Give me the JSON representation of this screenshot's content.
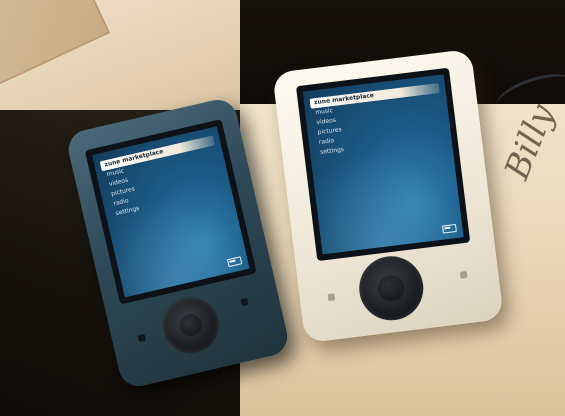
{
  "scene": {
    "description": "",
    "colors": {
      "dark_surface": "#17120d",
      "light_surface": "#ece0c6",
      "dark_device": "#2f4a58",
      "white_device": "#efe8d8",
      "screen_blue": "#1c5a86"
    }
  },
  "devices": {
    "dark": {
      "menu_items": [
        "zune marketplace",
        "music",
        "videos",
        "pictures",
        "radio",
        "settings"
      ],
      "selected_index": 0
    },
    "white": {
      "menu_items": [
        "zune marketplace",
        "music",
        "videos",
        "pictures",
        "radio",
        "settings"
      ],
      "selected_index": 0
    }
  },
  "handwriting": {
    "signature_billy": "Billy",
    "signature_scrawl": ""
  }
}
